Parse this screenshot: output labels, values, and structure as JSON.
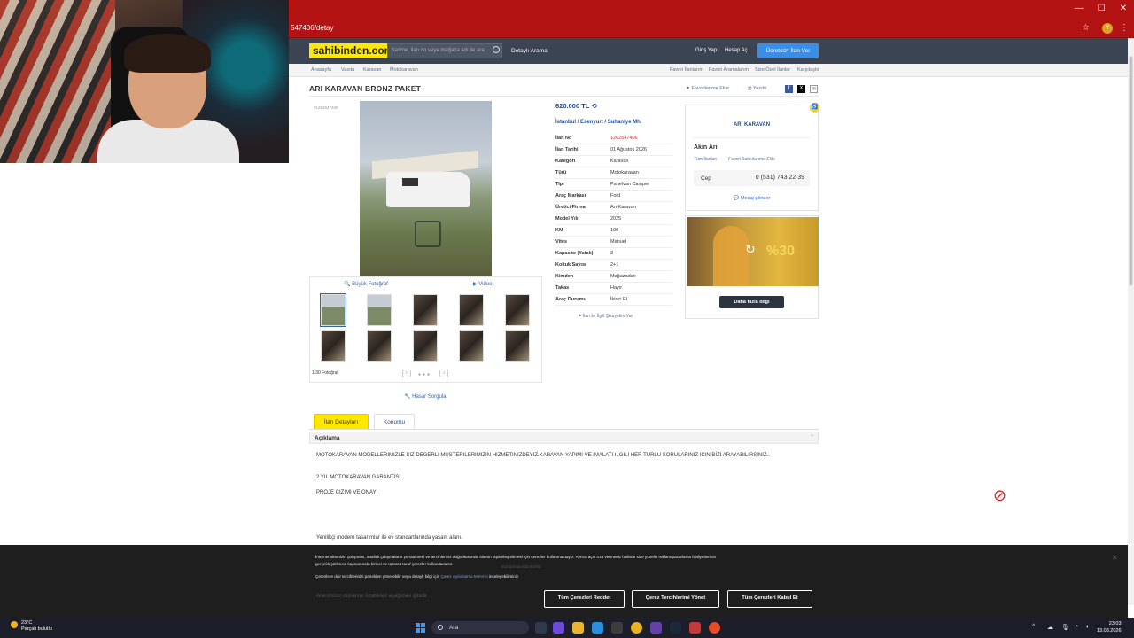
{
  "browser": {
    "url": "547406/detay"
  },
  "header": {
    "logo": "sahibinden.com",
    "search_placeholder": "Kelime, ilan no veya mağaza adı ile ara",
    "advanced_search": "Detaylı Arama",
    "login": "Giriş Yap",
    "register": "Hesap Aç",
    "post_ad": "Ücretsiz* İlan Ver"
  },
  "breadcrumb": [
    "Anasayfa",
    "Vasıta",
    "Karavan",
    "Motokaravan"
  ],
  "sublinks": [
    "Favori İlanlarım",
    "Favori Aramalarım",
    "Size Özel İlanlar",
    "Karşılaştır"
  ],
  "listing": {
    "title": "ARI KARAVAN BRONZ PAKET",
    "id_label": "#1262547406",
    "add_favorite": "Favorilerime Ekle",
    "print": "Yazdır",
    "price": "620.000 TL",
    "location": [
      "İstanbul",
      "Esenyurt",
      "Sultaniye Mh."
    ],
    "info": [
      {
        "key": "İlan No",
        "value": "1262547406"
      },
      {
        "key": "İlan Tarihi",
        "value": "01 Ağustos 2026"
      },
      {
        "key": "Kategori",
        "value": "Karavan"
      },
      {
        "key": "Türü",
        "value": "Motokaravan"
      },
      {
        "key": "Tipi",
        "value": "Panelvan Camper"
      },
      {
        "key": "Araç Markası",
        "value": "Ford"
      },
      {
        "key": "Üretici Firma",
        "value": "Arı Karavan"
      },
      {
        "key": "Model Yılı",
        "value": "2025"
      },
      {
        "key": "KM",
        "value": "100"
      },
      {
        "key": "Vites",
        "value": "Manuel"
      },
      {
        "key": "Kapasite (Yatak)",
        "value": "3"
      },
      {
        "key": "Koltuk Sayısı",
        "value": "2+1"
      },
      {
        "key": "Kimden",
        "value": "Mağazadan"
      },
      {
        "key": "Takas",
        "value": "Hayır"
      },
      {
        "key": "Araç Durumu",
        "value": "İkinci El"
      }
    ],
    "complaint": "İlan ile İlgili Şikayetim Var",
    "gallery": {
      "big_photo": "Büyük Fotoğraf",
      "video": "Video",
      "count": "1/30 Fotoğraf",
      "damage_query": "Hasar Sorgula"
    }
  },
  "seller": {
    "store": "ARI KARAVAN",
    "name": "Akın Arı",
    "all_ads": "Tüm İlanları",
    "add_fav_seller": "Favori Satıcılarıma Ekle",
    "phone_label": "Cep",
    "phone": "0 (531) 743 22 39",
    "send_message": "Mesaj gönder"
  },
  "ad": {
    "pct": "%30",
    "button": "Daha fazla bilgi"
  },
  "tabs": {
    "details": "İlan Detayları",
    "location": "Konumu"
  },
  "description": {
    "title": "Açıklama",
    "lines": [
      "MOTOKARAVAN MODELLERIMIZLE SIZ DEGERLI MUSTERILERIMIZIN HIZMETINIZDEYIZ.KARAVAN YAPIMI VE IMALATI ILGILI HER TURLU SORULARINIZ ICIN BİZİ ARAYABILIRSINIZ..",
      "2 YIL MOTOKARAVAN GARANTİSİ",
      "PROJE CIZIMI VE ONAYI",
      "Yenilikçi modern tasarımlar ile ev standartlarında yaşam alanı."
    ]
  },
  "cookie": {
    "text1": "İnternet sitemizin çalışması, analitik çalışmaların yürütülmesi ve tercihleriniz doğrultusunda sitenin kişiselleştirilmesi için çerezler kullanmaktayız. Ayrıca açık rıza vermeniz halinde size yönelik reklam/pazarlama faaliyetlerinin",
    "text2": "gerçekleştirilmesi kapsamında birinci ve üçüncü taraf çerezler kullanılacaktır.",
    "text3_pre": "Çerezlere dair tercihlerinizi panelden yönetebilir veya detaylı bilgi için",
    "text3_link": "Çerez Aydınlatma Metni'ni",
    "text3_post": "inceleyebilirsiniz.",
    "reject": "Tüm Çerezleri Reddet",
    "manage": "Çerez Tercihlerimi Yönet",
    "accept": "Tüm Çerezleri Kabul Et",
    "overlap_text": "standartlarında konfor",
    "bottom_text": "Aracımızın donanım özellikleri aşağıdaki gibidir."
  },
  "taskbar": {
    "temp": "23°C",
    "weather": "Parçalı bulutlu",
    "search": "Ara",
    "time": "23:03",
    "date": "13.08.2026"
  }
}
